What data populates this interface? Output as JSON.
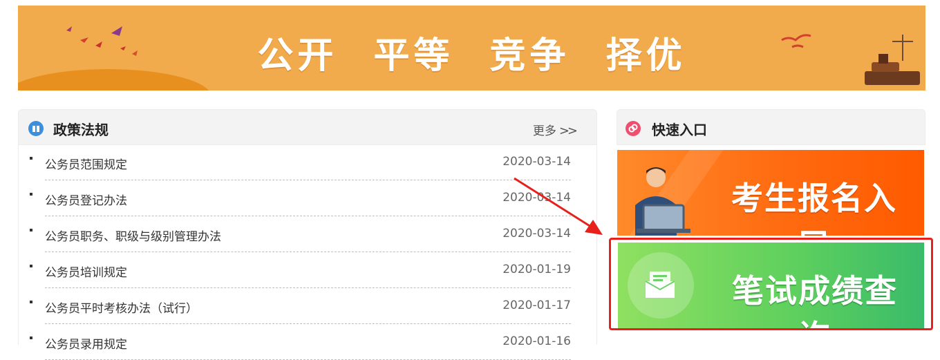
{
  "banner": {
    "slogan": "公开  平等  竞争  择优"
  },
  "policy_panel": {
    "title": "政策法规",
    "more_label": "更多",
    "more_arrows": ">>",
    "icon": "book-icon",
    "items": [
      {
        "title": "公务员范围规定",
        "date": "2020-03-14"
      },
      {
        "title": "公务员登记办法",
        "date": "2020-03-14"
      },
      {
        "title": "公务员职务、职级与级别管理办法",
        "date": "2020-03-14"
      },
      {
        "title": "公务员培训规定",
        "date": "2020-01-19"
      },
      {
        "title": "公务员平时考核办法（试行）",
        "date": "2020-01-17"
      },
      {
        "title": "公务员录用规定",
        "date": "2020-01-16"
      }
    ]
  },
  "quick_panel": {
    "title": "快速入口",
    "icon": "link-icon",
    "registration_label": "考生报名入口",
    "score_query_label": "笔试成绩查询"
  },
  "colors": {
    "banner_bg": "#f2ab4c",
    "registration_bg": "#ff6a10",
    "score_bg": "#5ccf5e",
    "highlight": "#e8201c"
  }
}
